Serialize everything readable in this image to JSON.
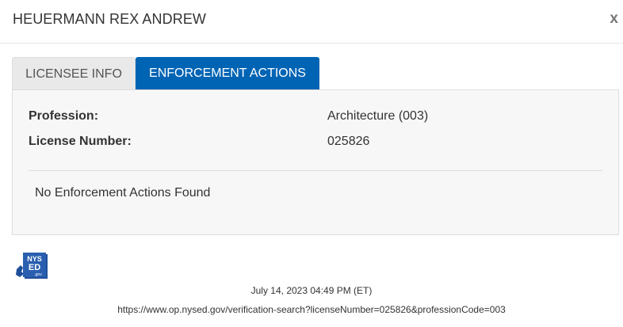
{
  "header": {
    "title": "HEUERMANN REX ANDREW",
    "close_label": "x"
  },
  "tabs": [
    {
      "label": "LICENSEE INFO",
      "active": false
    },
    {
      "label": "ENFORCEMENT ACTIONS",
      "active": true
    }
  ],
  "details": {
    "profession_label": "Profession:",
    "profession_value": "Architecture (003)",
    "license_label": "License Number:",
    "license_value": "025826",
    "enforcement_message": "No Enforcement Actions Found"
  },
  "logo": {
    "line1": "NYS",
    "line2": "ED",
    "line3": ".gov"
  },
  "footer": {
    "timestamp": "July 14, 2023 04:49 PM (ET)",
    "url": "https://www.op.nysed.gov/verification-search?licenseNumber=025826&professionCode=003"
  },
  "colors": {
    "active_tab": "#0064b4",
    "inactive_tab": "#e9e9e9",
    "panel_bg": "#f7f7f7",
    "logo_blue": "#1f4f9a"
  }
}
